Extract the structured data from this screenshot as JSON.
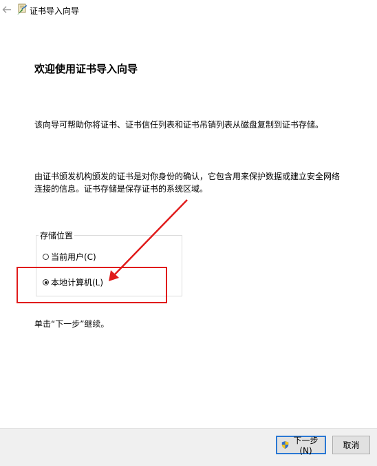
{
  "window": {
    "title": "证书导入向导"
  },
  "icons": {
    "back": "back-arrow-icon",
    "app": "certificate-icon",
    "shield": "uac-shield-icon"
  },
  "main": {
    "heading": "欢迎使用证书导入向导",
    "intro": "该向导可帮助你将证书、证书信任列表和证书吊销列表从磁盘复制到证书存储。",
    "description": "由证书颁发机构颁发的证书是对你身份的确认，它包含用来保护数据或建立安全网络连接的信息。证书存储是保存证书的系统区域。"
  },
  "store_location": {
    "label": "存储位置",
    "options": [
      {
        "label": "当前用户(C)",
        "selected": false
      },
      {
        "label": "本地计算机(L)",
        "selected": true
      }
    ]
  },
  "continue_text": "单击“下一步”继续。",
  "buttons": {
    "next": "下一步(N)",
    "cancel": "取消"
  },
  "annotation": {
    "color": "#e01b1b"
  }
}
